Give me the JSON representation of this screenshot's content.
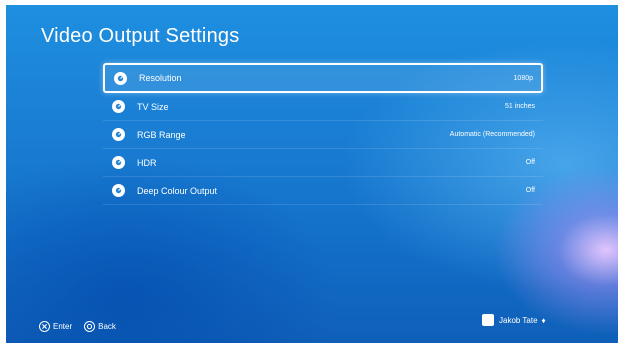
{
  "page": {
    "title": "Video Output Settings"
  },
  "settings": [
    {
      "label": "Resolution",
      "value": "1080p",
      "selected": true
    },
    {
      "label": "TV Size",
      "value": "51 inches",
      "selected": false
    },
    {
      "label": "RGB Range",
      "value": "Automatic (Recommended)",
      "selected": false
    },
    {
      "label": "HDR",
      "value": "Off",
      "selected": false
    },
    {
      "label": "Deep Colour Output",
      "value": "Off",
      "selected": false
    }
  ],
  "footer": {
    "enter_label": "Enter",
    "back_label": "Back",
    "user_name": "Jakob Tate",
    "user_extra_symbol": "♦"
  },
  "colors": {
    "background_top": "#1f8fe0",
    "background_bottom": "#0f5fb8",
    "text": "#ffffff"
  },
  "icons": {
    "row": "settings-dial-icon",
    "enter": "cross-button-icon",
    "back": "circle-button-icon",
    "user": "user-avatar"
  }
}
